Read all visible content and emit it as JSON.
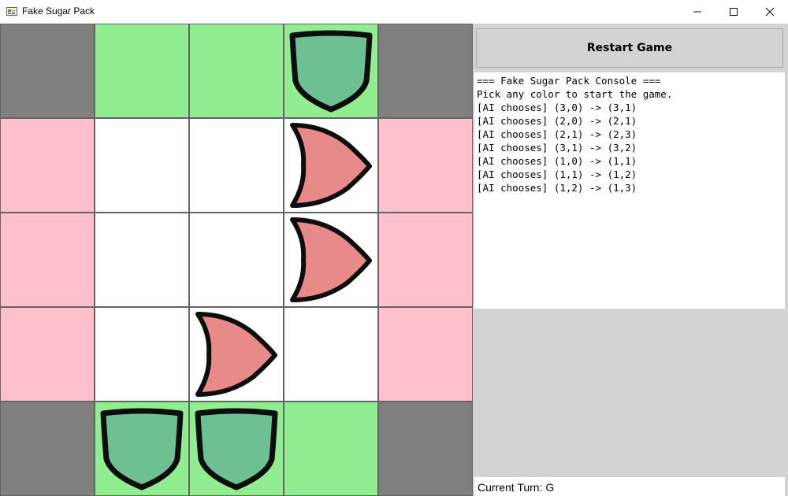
{
  "window": {
    "title": "Fake Sugar Pack"
  },
  "controls": {
    "restart_label": "Restart Game"
  },
  "board": {
    "rows": 5,
    "cols": 5,
    "cells": [
      [
        "gray",
        "green",
        "green",
        "green",
        "gray"
      ],
      [
        "pink",
        "white",
        "white",
        "white",
        "pink"
      ],
      [
        "pink",
        "white",
        "white",
        "white",
        "pink"
      ],
      [
        "pink",
        "white",
        "white",
        "white",
        "pink"
      ],
      [
        "gray",
        "green",
        "green",
        "green",
        "gray"
      ]
    ],
    "pieces": [
      {
        "row": 0,
        "col": 3,
        "type": "green-shield"
      },
      {
        "row": 1,
        "col": 3,
        "type": "red-arrow"
      },
      {
        "row": 2,
        "col": 3,
        "type": "red-arrow"
      },
      {
        "row": 3,
        "col": 2,
        "type": "red-arrow"
      },
      {
        "row": 4,
        "col": 1,
        "type": "green-shield"
      },
      {
        "row": 4,
        "col": 2,
        "type": "green-shield"
      }
    ]
  },
  "console": {
    "lines": [
      "=== Fake Sugar Pack Console ===",
      "Pick any color to start the game.",
      "[AI chooses] (3,0) -> (3,1)",
      "[AI chooses] (2,0) -> (2,1)",
      "[AI chooses] (2,1) -> (2,3)",
      "[AI chooses] (3,1) -> (3,2)",
      "[AI chooses] (1,0) -> (1,1)",
      "[AI chooses] (1,1) -> (1,2)",
      "[AI chooses] (1,2) -> (1,3)"
    ]
  },
  "status": {
    "turn_text": "Current Turn: G"
  },
  "colors": {
    "gray": "#808080",
    "green": "#90ee90",
    "pink": "#ffc0cb",
    "white": "#ffffff",
    "grid": "#646464",
    "shield_fill": "#6dbf94",
    "arrow_fill": "#e88a8a",
    "piece_outline": "#0d0d0d"
  },
  "icons": {
    "app": "app-icon",
    "minimize": "minimize-icon",
    "maximize": "maximize-icon",
    "close": "close-icon"
  }
}
